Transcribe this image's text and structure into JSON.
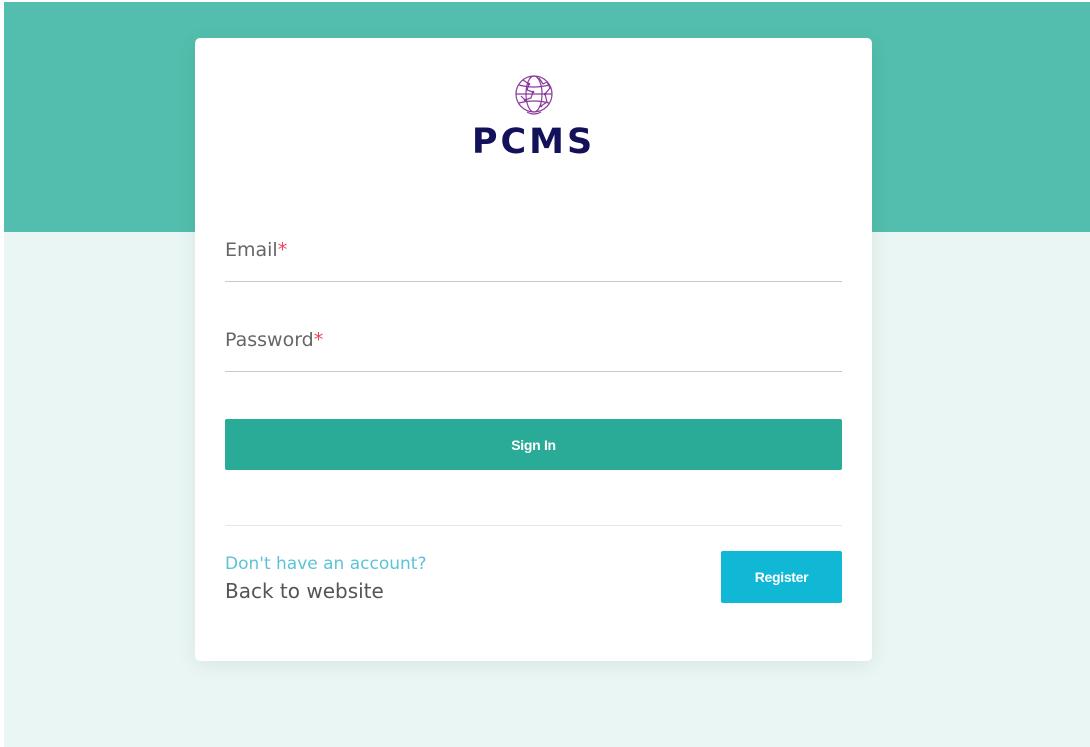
{
  "colors": {
    "top_band": "#53bead",
    "page_background": "#e9f6f3",
    "brand_text": "#13115a",
    "logo_icon": "#8b3a9c",
    "label_text": "#666666",
    "required_mark": "#e8475a",
    "signin_button": "#2aab98",
    "register_button": "#10b8d6",
    "link_blue": "#5bc3d8",
    "back_link": "#555555"
  },
  "logo": {
    "icon": "globe-map-icon",
    "brand": "PCMS"
  },
  "form": {
    "email": {
      "label": "Email",
      "required_mark": "*",
      "value": ""
    },
    "password": {
      "label": "Password",
      "required_mark": "*",
      "value": ""
    },
    "signin_label": "Sign In"
  },
  "footer": {
    "account_prompt": "Don't have an account?",
    "back_link": "Back to website",
    "register_label": "Register"
  }
}
